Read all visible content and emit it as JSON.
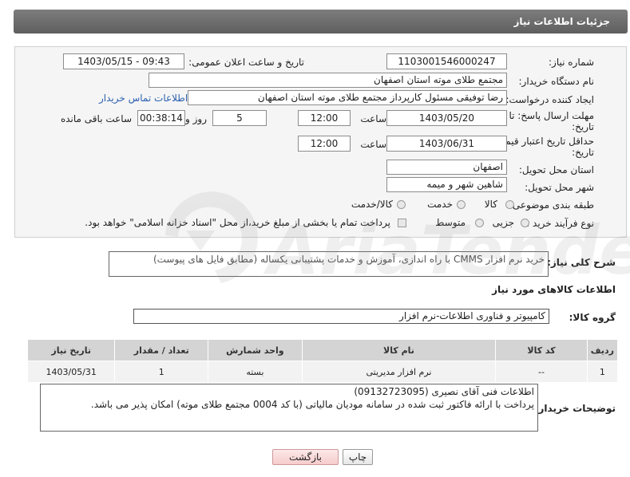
{
  "header": {
    "title": "جزئیات اطلاعات نیاز"
  },
  "form": {
    "need_number_label": "شماره نیاز:",
    "need_number": "1103001546000247",
    "announce_label": "تاریخ و ساعت اعلان عمومی:",
    "announce_value": "1403/05/15 - 09:43",
    "buyer_org_label": "نام دستگاه خریدار:",
    "buyer_org": "مجتمع طلای موته استان اصفهان",
    "requester_label": "ایجاد کننده درخواست:",
    "requester": "رضا توفیقی مسئول کارپرداز مجتمع طلای موته استان اصفهان",
    "contact_link": "اطلاعات تماس خریدار",
    "deadline_label_1": "مهلت ارسال پاسخ: تا",
    "deadline_label_2": "تاریخ:",
    "deadline_date": "1403/05/20",
    "time_label": "ساعت",
    "deadline_time": "12:00",
    "days_value": "5",
    "days_label": "روز و",
    "remaining_time": "00:38:14",
    "remaining_label": "ساعت باقی مانده",
    "validity_label_1": "حداقل تاریخ اعتبار قیمت: تا",
    "validity_label_2": "تاریخ:",
    "validity_date": "1403/06/31",
    "validity_time": "12:00",
    "province_label": "استان محل تحویل:",
    "province": "اصفهان",
    "city_label": "شهر محل تحویل:",
    "city": "شاهین شهر و میمه",
    "category_label": "طبقه بندی موضوعی:",
    "category_options": [
      "کالا",
      "خدمت",
      "کالا/خدمت"
    ],
    "process_label": "نوع فرآیند خرید :",
    "process_options": [
      "جزیی",
      "متوسط"
    ],
    "payment_note": "پرداخت تمام یا بخشی از مبلغ خرید،از محل \"اسناد خزانه اسلامی\" خواهد بود."
  },
  "description": {
    "label": "شرح کلی نیاز:",
    "text": "خرید نرم افزار CMMS با راه اندازی، آموزش و خدمات پشتیبانی یکساله (مطابق فایل های پیوست)"
  },
  "goods_info": {
    "title": "اطلاعات کالاهای مورد نیاز",
    "group_label": "گروه کالا:",
    "group_value": "کامپیوتر و فناوری اطلاعات-نرم افزار"
  },
  "table": {
    "headers": [
      "ردیف",
      "کد کالا",
      "نام کالا",
      "واحد شمارش",
      "تعداد / مقدار",
      "تاریخ نیاز"
    ],
    "rows": [
      [
        "1",
        "--",
        "نرم افزار مدیریتی",
        "بسته",
        "1",
        "1403/05/31"
      ]
    ]
  },
  "buyer_notes": {
    "label": "توضیحات خریدار:",
    "line1": "اطلاعات فنی آقای نصیری (09132723095)",
    "line2": "پرداخت با ارائه فاکتور ثبت شده در سامانه مودیان مالیاتی (با کد 0004 مجتمع طلای موته) امکان پذیر می باشد."
  },
  "buttons": {
    "print": "چاپ",
    "back": "بازگشت"
  }
}
